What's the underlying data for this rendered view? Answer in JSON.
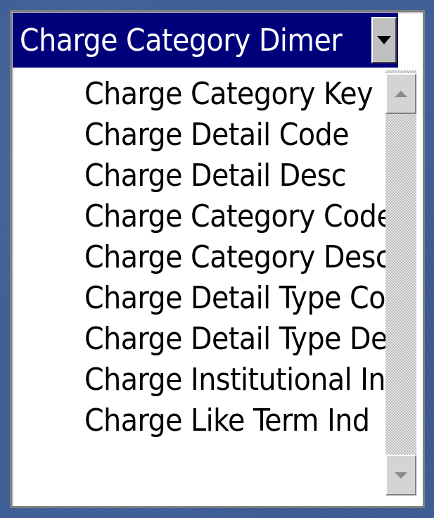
{
  "dropdown": {
    "selected_label": "Charge Category Dimer",
    "button_icon": "triangle-down-icon"
  },
  "list": {
    "items": [
      "Charge Category Key",
      "Charge Detail Code",
      "Charge Detail Desc",
      "Charge Category Code",
      "Charge Category Desc",
      "Charge Detail Type Co",
      "Charge Detail Type De",
      "Charge Institutional In",
      "Charge Like Term Ind"
    ]
  },
  "scrollbar": {
    "up_icon": "scroll-up-arrow-icon",
    "down_icon": "scroll-down-arrow-icon"
  },
  "colors": {
    "background": "#3d5e98",
    "title_bar": "#00007b",
    "list_bg": "#ffffff"
  }
}
